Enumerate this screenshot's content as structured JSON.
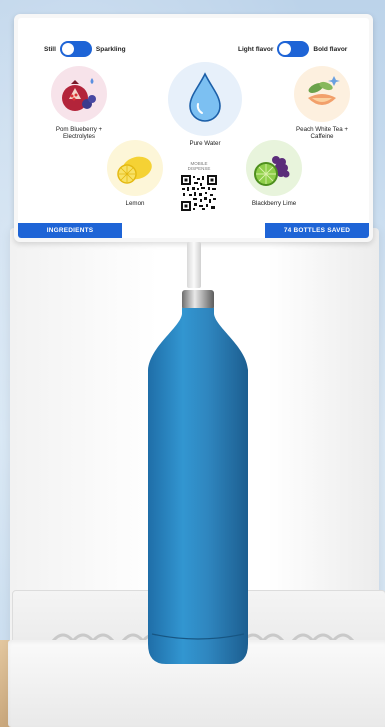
{
  "carbonation_toggle": {
    "left_label": "Still",
    "right_label": "Sparkling",
    "state": "still"
  },
  "flavor_toggle": {
    "left_label": "Light flavor",
    "right_label": "Bold flavor",
    "state": "light"
  },
  "options": [
    {
      "label": "Pom Blueberry + Electrolytes",
      "icon": "pomegranate-blueberry-icon"
    },
    {
      "label": "Pure Water",
      "icon": "water-drop-icon"
    },
    {
      "label": "Peach White Tea + Caffeine",
      "icon": "peach-tea-icon"
    },
    {
      "label": "Lemon",
      "icon": "lemon-icon"
    },
    {
      "label": "Blackberry Lime",
      "icon": "blackberry-lime-icon"
    }
  ],
  "mobile_dispense_label": "MOBILE DISPENSE",
  "buttons": {
    "ingredients": "INGREDIENTS",
    "bottles_saved": "74 BOTTLES SAVED"
  },
  "colors": {
    "accent": "#1e64d6",
    "bottle": "#2f86bf"
  }
}
